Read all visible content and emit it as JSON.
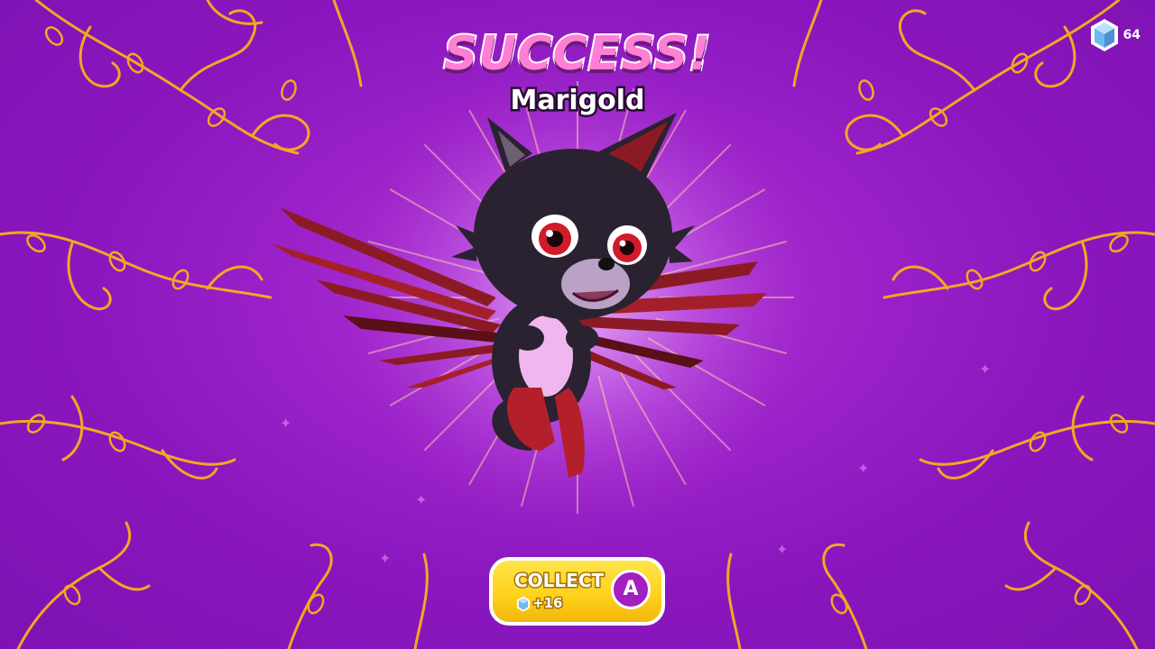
{
  "header": {
    "title": "SUCCESS!",
    "pet_name": "Marigold"
  },
  "currency": {
    "icon": "gem-icon",
    "amount": "64"
  },
  "collect_button": {
    "label": "COLLECT",
    "reward": "+16",
    "reward_icon": "gem-icon",
    "key_hint": "A"
  },
  "colors": {
    "background": "#8a17be",
    "title": "#ff7fd6",
    "vine": "#f5a623",
    "button": "#ffd21c",
    "key_badge": "#a41fc0"
  }
}
